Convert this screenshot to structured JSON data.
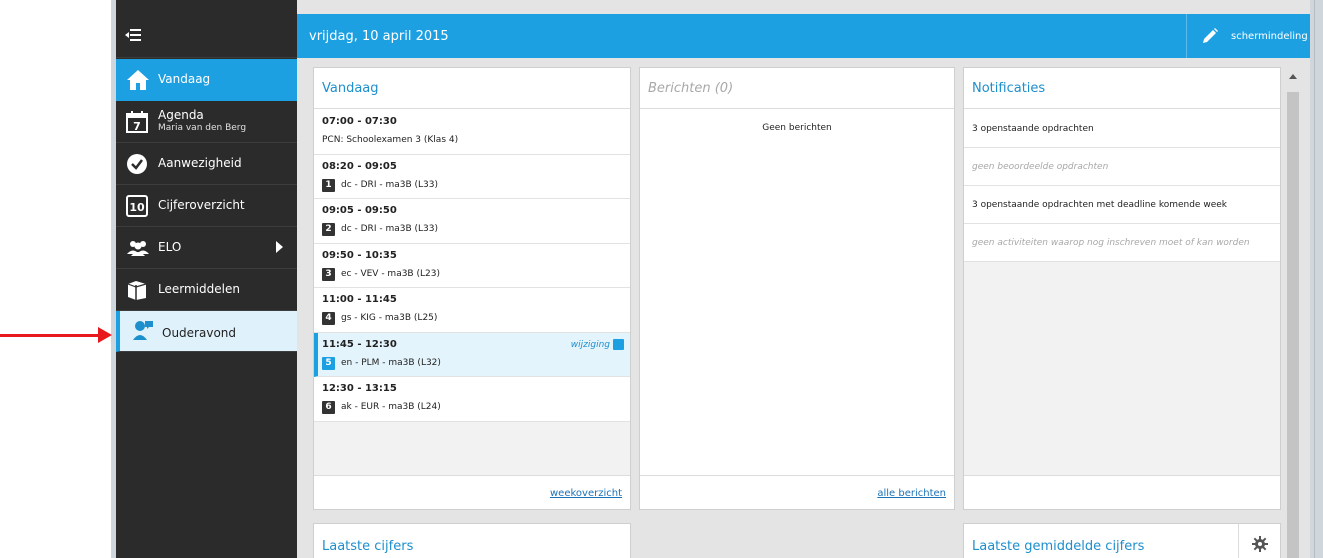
{
  "topbar": {
    "date": "vrijdag, 10 april 2015",
    "layout_label": "schermindeling"
  },
  "sidebar": {
    "items": [
      {
        "label": "Vandaag"
      },
      {
        "label": "Agenda",
        "sub": "Maria van den Berg",
        "icon_day": "7"
      },
      {
        "label": "Aanwezigheid"
      },
      {
        "label": "Cijferoverzicht",
        "icon_num": "10"
      },
      {
        "label": "ELO"
      },
      {
        "label": "Leermiddelen"
      },
      {
        "label": "Ouderavond"
      }
    ]
  },
  "today": {
    "title": "Vandaag",
    "rows": [
      {
        "time": "07:00 - 07:30",
        "desc": "PCN: Schoolexamen 3 (Klas 4)"
      },
      {
        "time": "08:20 - 09:05",
        "num": "1",
        "desc": "dc - DRI - ma3B (L33)"
      },
      {
        "time": "09:05 - 09:50",
        "num": "2",
        "desc": "dc - DRI - ma3B (L33)"
      },
      {
        "time": "09:50 - 10:35",
        "num": "3",
        "desc": "ec - VEV - ma3B (L23)"
      },
      {
        "time": "11:00 - 11:45",
        "num": "4",
        "desc": "gs - KIG - ma3B (L25)"
      },
      {
        "time": "11:45 - 12:30",
        "num": "5",
        "desc": "en - PLM - ma3B (L32)",
        "change": "wijziging"
      },
      {
        "time": "12:30 - 13:15",
        "num": "6",
        "desc": "ak - EUR - ma3B (L24)"
      }
    ],
    "footer_link": "weekoverzicht"
  },
  "messages": {
    "title": "Berichten (0)",
    "empty": "Geen berichten",
    "footer_link": "alle berichten"
  },
  "notifications": {
    "title": "Notificaties",
    "rows": [
      {
        "text": "3 openstaande opdrachten"
      },
      {
        "text": "geen beoordeelde opdrachten"
      },
      {
        "text": "3 openstaande opdrachten met deadline komende week"
      },
      {
        "text": "geen activiteiten waarop nog inschreven moet of kan worden"
      }
    ]
  },
  "latest_grades": {
    "title": "Laatste cijfers"
  },
  "latest_avg_grades": {
    "title": "Laatste gemiddelde cijfers"
  },
  "colors": {
    "accent": "#1da0e2",
    "sidebar": "#2b2b2b",
    "annotation": "#e8191c"
  }
}
